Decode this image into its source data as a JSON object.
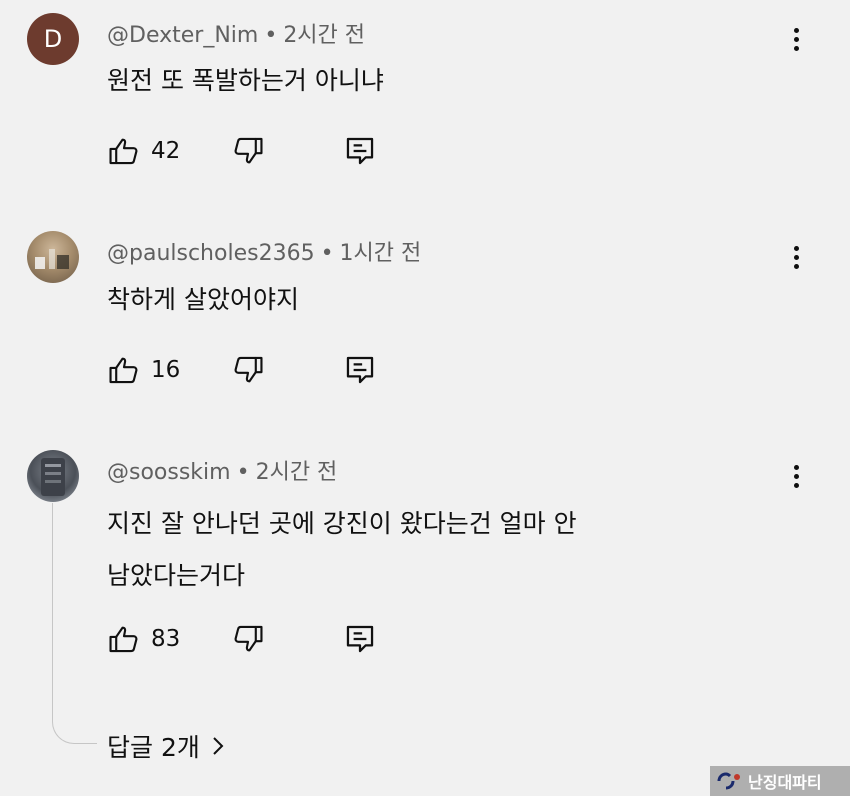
{
  "comments": [
    {
      "avatar_letter": "D",
      "username": "@Dexter_Nim",
      "time": "2시간 전",
      "text_lines": [
        "원전 또 폭발하는거 아니냐"
      ],
      "likes": "42"
    },
    {
      "username": "@paulscholes2365",
      "time": "1시간 전",
      "text_lines": [
        "착하게 살았어야지"
      ],
      "likes": "16"
    },
    {
      "username": "@soosskim",
      "time": "2시간 전",
      "text_lines": [
        "지진 잘 안나던 곳에 강진이 왔다는건 얼마 안",
        "남았다는거다"
      ],
      "likes": "83",
      "replies_label": "답글 2개"
    }
  ],
  "separator": "•",
  "watermark": "난징대파티"
}
